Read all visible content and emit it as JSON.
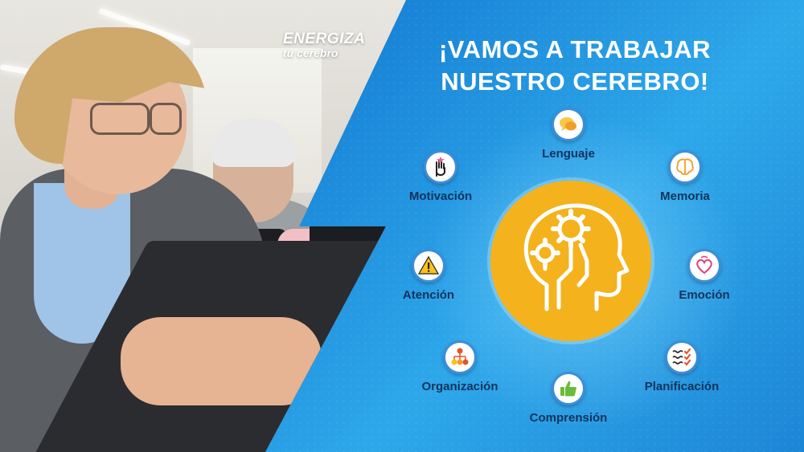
{
  "brand": {
    "line1": "ENERGIZA",
    "line2": "tu cerebro"
  },
  "title": {
    "line1": "¡VAMOS A TRABAJAR",
    "line2": "NUESTRO CEREBRO!"
  },
  "skills": {
    "lenguaje": {
      "label": "Lenguaje",
      "icon": "speech-bubbles-icon"
    },
    "motivacion": {
      "label": "Motivación",
      "icon": "raised-hand-icon"
    },
    "memoria": {
      "label": "Memoria",
      "icon": "brain-icon"
    },
    "atencion": {
      "label": "Atención",
      "icon": "warning-icon"
    },
    "emocion": {
      "label": "Emoción",
      "icon": "heart-icon"
    },
    "organizacion": {
      "label": "Organización",
      "icon": "org-chart-icon"
    },
    "comprension": {
      "label": "Comprensión",
      "icon": "thumbs-up-icon"
    },
    "planificacion": {
      "label": "Planificación",
      "icon": "checklist-icon"
    }
  },
  "colors": {
    "accent": "#f4b21c",
    "background": "#1a86d8",
    "label": "#12335c",
    "badge_ring": "#3d8ed8"
  }
}
